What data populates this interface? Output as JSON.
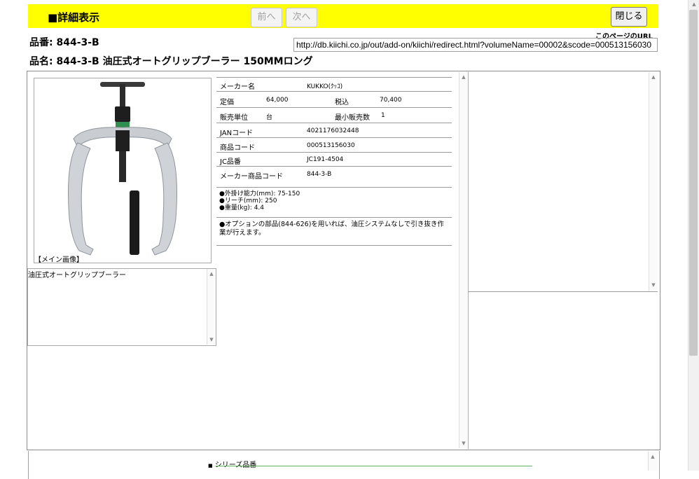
{
  "header": {
    "title": "■詳細表示",
    "prev_label": "前へ",
    "next_label": "次へ",
    "close_label": "閉じる"
  },
  "product": {
    "number_line": "品番: 844-3-B",
    "name_line": "品名: 844-3-B 油圧式オートグリップブーラー 150MMロング"
  },
  "page_url": {
    "label": "このページのURL",
    "value": "http://db.kiichi.co.jp/out/add-on/kiichi/redirect.html?volumeName=00002&scode=000513156030"
  },
  "image": {
    "caption": "【メイン画像】"
  },
  "description": "油圧式オートグリップブーラー",
  "details": {
    "maker_label": "メーカー名",
    "maker_value": "KUKKO(ｸｯｺ)",
    "price_label": "定価",
    "price_value": "64,000",
    "tax_label": "税込",
    "tax_value": "70,400",
    "unit_label": "販売単位",
    "unit_value": "台",
    "min_label": "最小販売数",
    "min_value": "1",
    "jan_label": "JANコード",
    "jan_value": "4021176032448",
    "code_label": "商品コード",
    "code_value": "000513156030",
    "jc_label": "JC品番",
    "jc_value": "JC191-4504",
    "maker_code_label": "メーカー商品コード",
    "maker_code_value": "844-3-B"
  },
  "specs": [
    "●外掛け能力(mm): 75-150",
    "●リーチ(mm): 250",
    "●重量(kg): 4.4"
  ],
  "note": "●オプションの部品(844-626)を用いれば、油圧システムなしで引き抜き作業が行えます。",
  "series": {
    "label": "シリーズ品番"
  }
}
